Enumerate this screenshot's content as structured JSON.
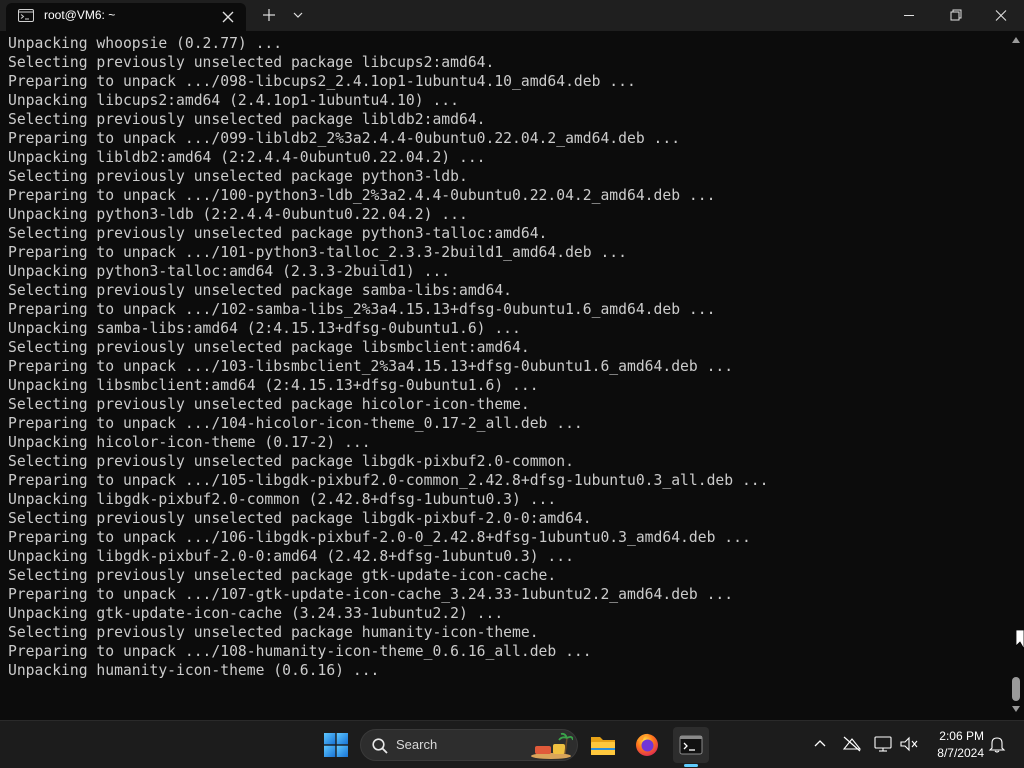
{
  "window": {
    "tab_title": "root@VM6: ~",
    "tab_icon": "terminal-app-icon",
    "buttons": [
      "close-tab-icon",
      "new-tab-icon",
      "tab-dropdown-icon",
      "minimize-icon",
      "maximize-icon",
      "close-window-icon"
    ]
  },
  "terminal": {
    "foreground": "#cccccc",
    "background": "#0c0c0c",
    "lines": [
      "Unpacking whoopsie (0.2.77) ...",
      "Selecting previously unselected package libcups2:amd64.",
      "Preparing to unpack .../098-libcups2_2.4.1op1-1ubuntu4.10_amd64.deb ...",
      "Unpacking libcups2:amd64 (2.4.1op1-1ubuntu4.10) ...",
      "Selecting previously unselected package libldb2:amd64.",
      "Preparing to unpack .../099-libldb2_2%3a2.4.4-0ubuntu0.22.04.2_amd64.deb ...",
      "Unpacking libldb2:amd64 (2:2.4.4-0ubuntu0.22.04.2) ...",
      "Selecting previously unselected package python3-ldb.",
      "Preparing to unpack .../100-python3-ldb_2%3a2.4.4-0ubuntu0.22.04.2_amd64.deb ...",
      "Unpacking python3-ldb (2:2.4.4-0ubuntu0.22.04.2) ...",
      "Selecting previously unselected package python3-talloc:amd64.",
      "Preparing to unpack .../101-python3-talloc_2.3.3-2build1_amd64.deb ...",
      "Unpacking python3-talloc:amd64 (2.3.3-2build1) ...",
      "Selecting previously unselected package samba-libs:amd64.",
      "Preparing to unpack .../102-samba-libs_2%3a4.15.13+dfsg-0ubuntu1.6_amd64.deb ...",
      "Unpacking samba-libs:amd64 (2:4.15.13+dfsg-0ubuntu1.6) ...",
      "Selecting previously unselected package libsmbclient:amd64.",
      "Preparing to unpack .../103-libsmbclient_2%3a4.15.13+dfsg-0ubuntu1.6_amd64.deb ...",
      "Unpacking libsmbclient:amd64 (2:4.15.13+dfsg-0ubuntu1.6) ...",
      "Selecting previously unselected package hicolor-icon-theme.",
      "Preparing to unpack .../104-hicolor-icon-theme_0.17-2_all.deb ...",
      "Unpacking hicolor-icon-theme (0.17-2) ...",
      "Selecting previously unselected package libgdk-pixbuf2.0-common.",
      "Preparing to unpack .../105-libgdk-pixbuf2.0-common_2.42.8+dfsg-1ubuntu0.3_all.deb ...",
      "Unpacking libgdk-pixbuf2.0-common (2.42.8+dfsg-1ubuntu0.3) ...",
      "Selecting previously unselected package libgdk-pixbuf-2.0-0:amd64.",
      "Preparing to unpack .../106-libgdk-pixbuf-2.0-0_2.42.8+dfsg-1ubuntu0.3_amd64.deb ...",
      "Unpacking libgdk-pixbuf-2.0-0:amd64 (2.42.8+dfsg-1ubuntu0.3) ...",
      "Selecting previously unselected package gtk-update-icon-cache.",
      "Preparing to unpack .../107-gtk-update-icon-cache_3.24.33-1ubuntu2.2_amd64.deb ...",
      "Unpacking gtk-update-icon-cache (3.24.33-1ubuntu2.2) ...",
      "Selecting previously unselected package humanity-icon-theme.",
      "Preparing to unpack .../108-humanity-icon-theme_0.6.16_all.deb ...",
      "Unpacking humanity-icon-theme (0.6.16) ..."
    ],
    "scrollbar_position": 0.96
  },
  "taskbar": {
    "search_label": "Search",
    "apps": [
      "windows-start-icon",
      "file-explorer-icon",
      "firefox-icon",
      "terminal-icon"
    ],
    "active_app": "terminal-icon",
    "active_indicator_color": "#60cdff",
    "tray_icons": [
      "chevron-up-icon",
      "network-off-icon",
      "display-icon",
      "volume-muted-icon",
      "notification-bell-icon"
    ],
    "clock_time": "2:06 PM",
    "clock_date": "8/7/2024"
  }
}
